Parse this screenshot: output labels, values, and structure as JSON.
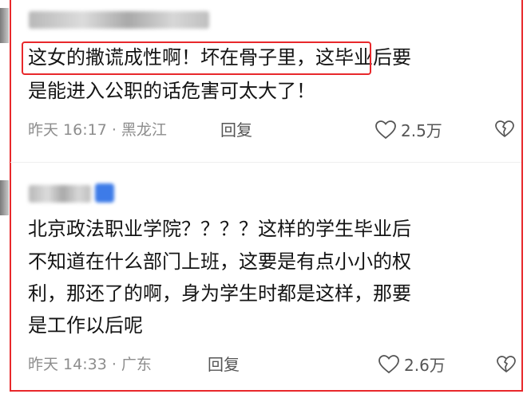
{
  "comments": [
    {
      "text_lines": [
        "这女的撒谎成性啊！坏在骨子里，这毕业后要",
        "是能进入公职的话危害可太大了！"
      ],
      "meta": "昨天 16:17 · 黑龙江",
      "reply_label": "回复",
      "likes": "2.5万"
    },
    {
      "text_lines": [
        "北京政法职业学院？？？？这样的学生毕业后",
        "不知道在什么部门上班，这要是有点小小的权",
        "利，那还了的啊，身为学生时都是这样，那要",
        "是工作以后呢"
      ],
      "meta": "昨天 14:33 · 广东",
      "reply_label": "回复",
      "likes": "2.6万"
    }
  ],
  "colors": {
    "highlight_border": "#e8282b",
    "meta_text": "#8d8d8d"
  },
  "icons": [
    "heart-icon",
    "broken-heart-icon"
  ]
}
